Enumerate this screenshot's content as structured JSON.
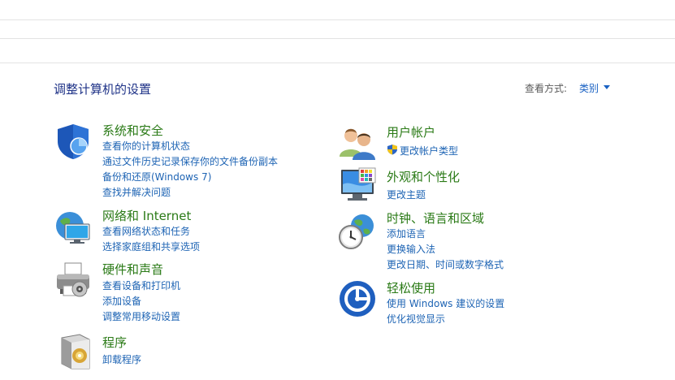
{
  "page": {
    "title": "调整计算机的设置",
    "view_by_label": "查看方式:",
    "view_by_value": "类别"
  },
  "categories": {
    "system": {
      "title": "系统和安全",
      "links": [
        "查看你的计算机状态",
        "通过文件历史记录保存你的文件备份副本",
        "备份和还原(Windows 7)",
        "查找并解决问题"
      ]
    },
    "network": {
      "title": "网络和 Internet",
      "links": [
        "查看网络状态和任务",
        "选择家庭组和共享选项"
      ]
    },
    "hardware": {
      "title": "硬件和声音",
      "links": [
        "查看设备和打印机",
        "添加设备",
        "调整常用移动设置"
      ]
    },
    "programs": {
      "title": "程序",
      "links": [
        "卸载程序"
      ]
    },
    "user": {
      "title": "用户帐户",
      "links": [
        "更改帐户类型"
      ]
    },
    "appearance": {
      "title": "外观和个性化",
      "links": [
        "更改主题"
      ]
    },
    "clock": {
      "title": "时钟、语言和区域",
      "links": [
        "添加语言",
        "更换输入法",
        "更改日期、时间或数字格式"
      ]
    },
    "ease": {
      "title": "轻松使用",
      "links": [
        "使用 Windows 建议的设置",
        "优化视觉显示"
      ]
    }
  },
  "icons": {
    "system": "shield-icon",
    "network": "network-globe-icon",
    "hardware": "printer-icon",
    "programs": "programs-box-icon",
    "user": "users-icon",
    "appearance": "monitor-palette-icon",
    "clock": "clock-globe-icon",
    "ease": "ease-of-access-icon",
    "uac": "uac-shield-icon"
  },
  "colors": {
    "category_title": "#2a7a16",
    "link": "#1e64b4",
    "page_title": "#1e3287"
  }
}
